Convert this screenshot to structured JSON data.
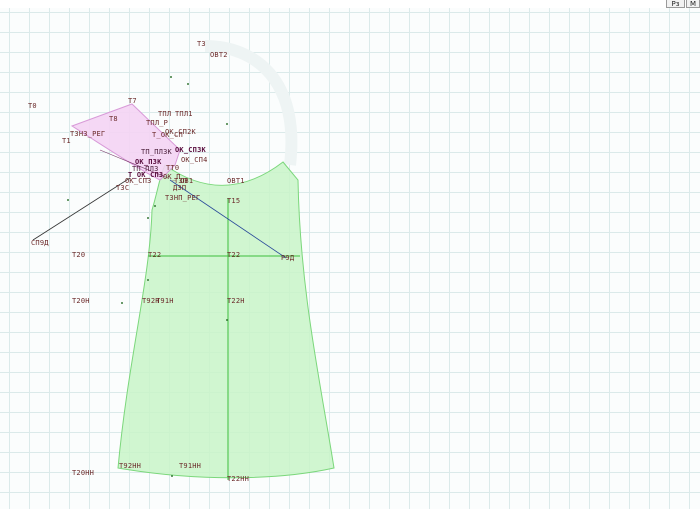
{
  "toolbar": {
    "button_a": "Рз",
    "button_b": "М"
  },
  "colors": {
    "bodice_fill": "#c8f5c8",
    "bodice_stroke": "#7bd77b",
    "sleeve_fill": "#f4d4f4",
    "sleeve_stroke": "#d89ad8",
    "grid": "#dbeaea",
    "label": "#6b2a2a"
  },
  "points": {
    "T3": "Т3",
    "OBT2": "ОВТ2",
    "T0": "Т0",
    "T7": "Т7",
    "T8": "Т8",
    "TPL": "ТПЛ",
    "TPL1": "ТПЛ1",
    "TPL_R": "ТПЛ_Р",
    "T1": "Т1",
    "T3N3_REG": "Т3НЗ_РЕГ",
    "TOK_SP2K": "ОК_СП2К",
    "TTOK_SP": "Т_ОК_СП",
    "OK_SP3K": "ОК_СП3К",
    "TP_PL3K": "ТП_ПЛ3К",
    "OK_SP4": "ОК_СП4",
    "OK_P3K": "ОК_П3К",
    "TP_PL3": "ТП_ПЛ3",
    "TT0": "ТТ0",
    "T_OK_SP3": "Т_ОК_СП3",
    "OK_P": "ОК_П",
    "OK_SP3": "ОК_СП3",
    "OK_SPL": "ОК_СП3",
    "T3P": "Т3П",
    "OB1": "ОВ1",
    "OBT1": "ОВТ1",
    "T3OP": "Т3ОП",
    "T3S": "Т3С",
    "DSP": "ДЗП",
    "T3NP_REG": "Т3НП_РЕГ",
    "T15": "Т15",
    "SP9D": "СП9Д",
    "T20": "Т20",
    "T22_left": "Т22",
    "T22": "Т22",
    "P9D": "Р9Д",
    "T20N": "Т20Н",
    "T92N": "Т92Н",
    "T91N": "Т91Н",
    "T22N": "Т22Н",
    "T20NN": "Т20НН",
    "T92NN": "Т92НН",
    "T91NN": "Т91НН",
    "T22NN": "Т22НН"
  }
}
